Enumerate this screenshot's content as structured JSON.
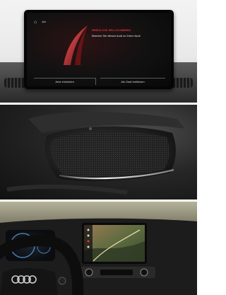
{
  "screen": {
    "heading": "Herzlich willkommen",
    "message": "Machen Sie diesen Audi zu Ihrem Audi",
    "left_button": "Jetzt einrichten",
    "right_button": "Als Gast fortfahren"
  },
  "cockpit": {
    "logo": "four-rings"
  },
  "colors": {
    "accent_red": "#e23b3b",
    "ambient_light": "#e8e8e8"
  }
}
